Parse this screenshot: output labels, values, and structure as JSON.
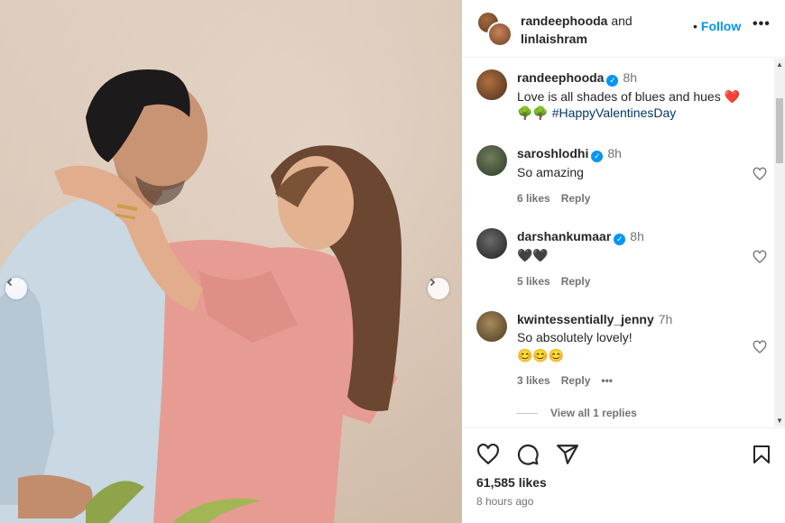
{
  "header": {
    "user1": "randeephooda",
    "and_text": "and",
    "user2": "linlaishram",
    "follow_dot": "•",
    "follow_label": "Follow",
    "more_label": "•••"
  },
  "caption": {
    "user": "randeephooda",
    "time": "8h",
    "text": "Love is all shades of blues and hues ❤️",
    "emojis": "🌳🌳",
    "hashtag": "#HappyValentinesDay"
  },
  "comments": [
    {
      "user": "saroshlodhi",
      "verified": true,
      "time": "8h",
      "text": "So amazing",
      "likes": "6 likes",
      "reply": "Reply"
    },
    {
      "user": "darshankumaar",
      "verified": true,
      "time": "8h",
      "text": "🖤🖤",
      "likes": "5 likes",
      "reply": "Reply"
    },
    {
      "user": "kwintessentially_jenny",
      "verified": false,
      "time": "7h",
      "text": "So absolutely lovely!",
      "text2": "😊😊😊",
      "likes": "3 likes",
      "reply": "Reply",
      "more": "•••"
    }
  ],
  "view_replies": "View all 1 replies",
  "footer": {
    "likes": "61,585 likes",
    "time_ago": "8 hours ago"
  },
  "colors": {
    "follow_blue": "#0095f6",
    "verified_blue": "#0095f6",
    "muted_text": "#737373",
    "hashtag": "#00376b"
  },
  "icons": [
    "chevron-left-icon",
    "chevron-right-icon",
    "more-icon",
    "verified-icon",
    "heart-icon",
    "comment-icon",
    "share-icon",
    "bookmark-icon"
  ]
}
